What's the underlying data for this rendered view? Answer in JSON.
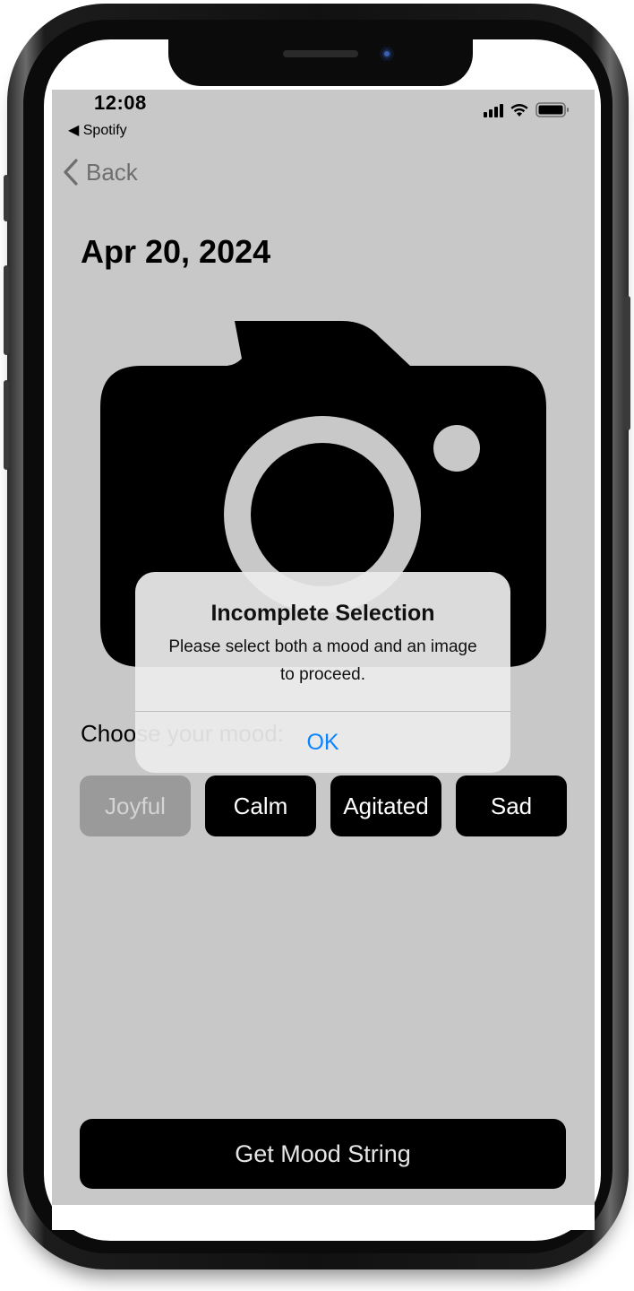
{
  "status_bar": {
    "time": "12:08",
    "back_to_app": "◀ Spotify",
    "icons": [
      "cellular-signal-icon",
      "wifi-icon",
      "battery-icon"
    ]
  },
  "navigation": {
    "back_label": "Back",
    "back_icon": "chevron-left-icon"
  },
  "page": {
    "date_title": "Apr 20, 2024",
    "image_placeholder_icon": "camera-icon",
    "choose_label": "Choose your mood:"
  },
  "moods": [
    {
      "label": "Joyful",
      "selected": true
    },
    {
      "label": "Calm",
      "selected": false
    },
    {
      "label": "Agitated",
      "selected": false
    },
    {
      "label": "Sad",
      "selected": false
    }
  ],
  "primary_action": {
    "label": "Get Mood String"
  },
  "alert": {
    "title": "Incomplete Selection",
    "message": "Please select both a mood and an image to proceed.",
    "ok_label": "OK"
  },
  "colors": {
    "screen_background": "#c8c8c8",
    "button_background": "#000000",
    "selected_mood_background": "#9a9a9a",
    "alert_action": "#0a84ff"
  }
}
